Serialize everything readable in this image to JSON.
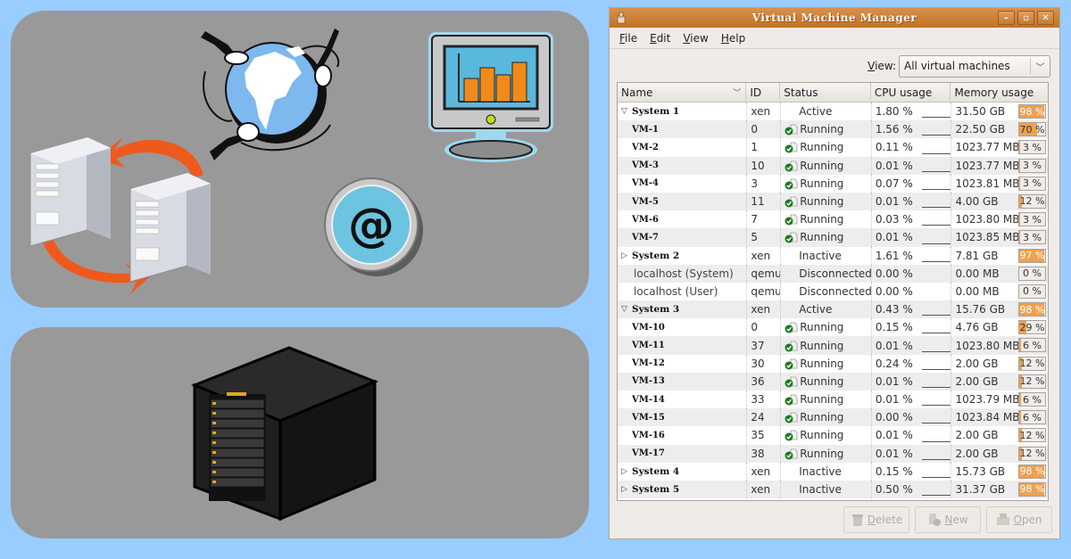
{
  "window": {
    "title": "Virtual Machine Manager",
    "controls": [
      "minimize",
      "maximize",
      "close"
    ]
  },
  "menu": [
    {
      "label": "File",
      "mnemonic": "F"
    },
    {
      "label": "Edit",
      "mnemonic": "E"
    },
    {
      "label": "View",
      "mnemonic": "V"
    },
    {
      "label": "Help",
      "mnemonic": "H"
    }
  ],
  "view_filter": {
    "label": "View:",
    "selected": "All virtual machines"
  },
  "columns": [
    "Name",
    "ID",
    "Status",
    "CPU usage",
    "Memory usage"
  ],
  "rows": [
    {
      "kind": "host",
      "expanded": true,
      "name": "System 1",
      "id": "xen",
      "status": "Active",
      "cpu": "1.80 %",
      "mem": "31.50 GB",
      "mem_pct": 98,
      "mem_label": "98 %"
    },
    {
      "kind": "vm",
      "name": "VM-1",
      "id": "0",
      "status": "Running",
      "cpu": "1.56 %",
      "mem": "22.50 GB",
      "mem_pct": 70,
      "mem_label": "70 %"
    },
    {
      "kind": "vm",
      "name": "VM-2",
      "id": "1",
      "status": "Running",
      "cpu": "0.11 %",
      "mem": "1023.77 MB",
      "mem_pct": 3,
      "mem_label": "3 %"
    },
    {
      "kind": "vm",
      "name": "VM-3",
      "id": "10",
      "status": "Running",
      "cpu": "0.01 %",
      "mem": "1023.77 MB",
      "mem_pct": 3,
      "mem_label": "3 %"
    },
    {
      "kind": "vm",
      "name": "VM-4",
      "id": "3",
      "status": "Running",
      "cpu": "0.07 %",
      "mem": "1023.81 MB",
      "mem_pct": 3,
      "mem_label": "3 %"
    },
    {
      "kind": "vm",
      "name": "VM-5",
      "id": "11",
      "status": "Running",
      "cpu": "0.01 %",
      "mem": "4.00 GB",
      "mem_pct": 12,
      "mem_label": "12 %"
    },
    {
      "kind": "vm",
      "name": "VM-6",
      "id": "7",
      "status": "Running",
      "cpu": "0.03 %",
      "mem": "1023.80 MB",
      "mem_pct": 3,
      "mem_label": "3 %"
    },
    {
      "kind": "vm",
      "name": "VM-7",
      "id": "5",
      "status": "Running",
      "cpu": "0.01 %",
      "mem": "1023.85 MB",
      "mem_pct": 3,
      "mem_label": "3 %"
    },
    {
      "kind": "host",
      "expanded": false,
      "name": "System 2",
      "id": "xen",
      "status": "Inactive",
      "cpu": "1.61 %",
      "mem": "7.81 GB",
      "mem_pct": 97,
      "mem_label": "97 %"
    },
    {
      "kind": "conn",
      "name": "localhost (System)",
      "id": "qemu",
      "status": "Disconnected",
      "cpu": "0.00 %",
      "mem": "0.00 MB",
      "mem_pct": 0,
      "mem_label": "0 %"
    },
    {
      "kind": "conn",
      "name": "localhost (User)",
      "id": "qemu",
      "status": "Disconnected",
      "cpu": "0.00 %",
      "mem": "0.00 MB",
      "mem_pct": 0,
      "mem_label": "0 %"
    },
    {
      "kind": "host",
      "expanded": true,
      "name": "System 3",
      "id": "xen",
      "status": "Active",
      "cpu": "0.43 %",
      "mem": "15.76 GB",
      "mem_pct": 98,
      "mem_label": "98 %"
    },
    {
      "kind": "vm",
      "name": "VM-10",
      "id": "0",
      "status": "Running",
      "cpu": "0.15 %",
      "mem": "4.76 GB",
      "mem_pct": 29,
      "mem_label": "29 %"
    },
    {
      "kind": "vm",
      "name": "VM-11",
      "id": "37",
      "status": "Running",
      "cpu": "0.01 %",
      "mem": "1023.80 MB",
      "mem_pct": 6,
      "mem_label": "6 %"
    },
    {
      "kind": "vm",
      "name": "VM-12",
      "id": "30",
      "status": "Running",
      "cpu": "0.24 %",
      "mem": "2.00 GB",
      "mem_pct": 12,
      "mem_label": "12 %"
    },
    {
      "kind": "vm",
      "name": "VM-13",
      "id": "36",
      "status": "Running",
      "cpu": "0.01 %",
      "mem": "2.00 GB",
      "mem_pct": 12,
      "mem_label": "12 %"
    },
    {
      "kind": "vm",
      "name": "VM-14",
      "id": "33",
      "status": "Running",
      "cpu": "0.01 %",
      "mem": "1023.79 MB",
      "mem_pct": 6,
      "mem_label": "6 %"
    },
    {
      "kind": "vm",
      "name": "VM-15",
      "id": "24",
      "status": "Running",
      "cpu": "0.00 %",
      "mem": "1023.84 MB",
      "mem_pct": 6,
      "mem_label": "6 %"
    },
    {
      "kind": "vm",
      "name": "VM-16",
      "id": "35",
      "status": "Running",
      "cpu": "0.01 %",
      "mem": "2.00 GB",
      "mem_pct": 12,
      "mem_label": "12 %"
    },
    {
      "kind": "vm",
      "name": "VM-17",
      "id": "38",
      "status": "Running",
      "cpu": "0.01 %",
      "mem": "2.00 GB",
      "mem_pct": 12,
      "mem_label": "12 %"
    },
    {
      "kind": "host",
      "expanded": false,
      "name": "System 4",
      "id": "xen",
      "status": "Inactive",
      "cpu": "0.15 %",
      "mem": "15.73 GB",
      "mem_pct": 98,
      "mem_label": "98 %"
    },
    {
      "kind": "host",
      "expanded": false,
      "name": "System 5",
      "id": "xen",
      "status": "Inactive",
      "cpu": "0.50 %",
      "mem": "31.37 GB",
      "mem_pct": 98,
      "mem_label": "98 %"
    }
  ],
  "buttons": {
    "delete": "Delete",
    "new": "New",
    "open": "Open"
  },
  "illustration": {
    "at_symbol": "@"
  },
  "colors": {
    "background": "#99ccff",
    "panel": "#999999",
    "titlebar": "#c9803a",
    "mem_fill": "#f0a050"
  }
}
